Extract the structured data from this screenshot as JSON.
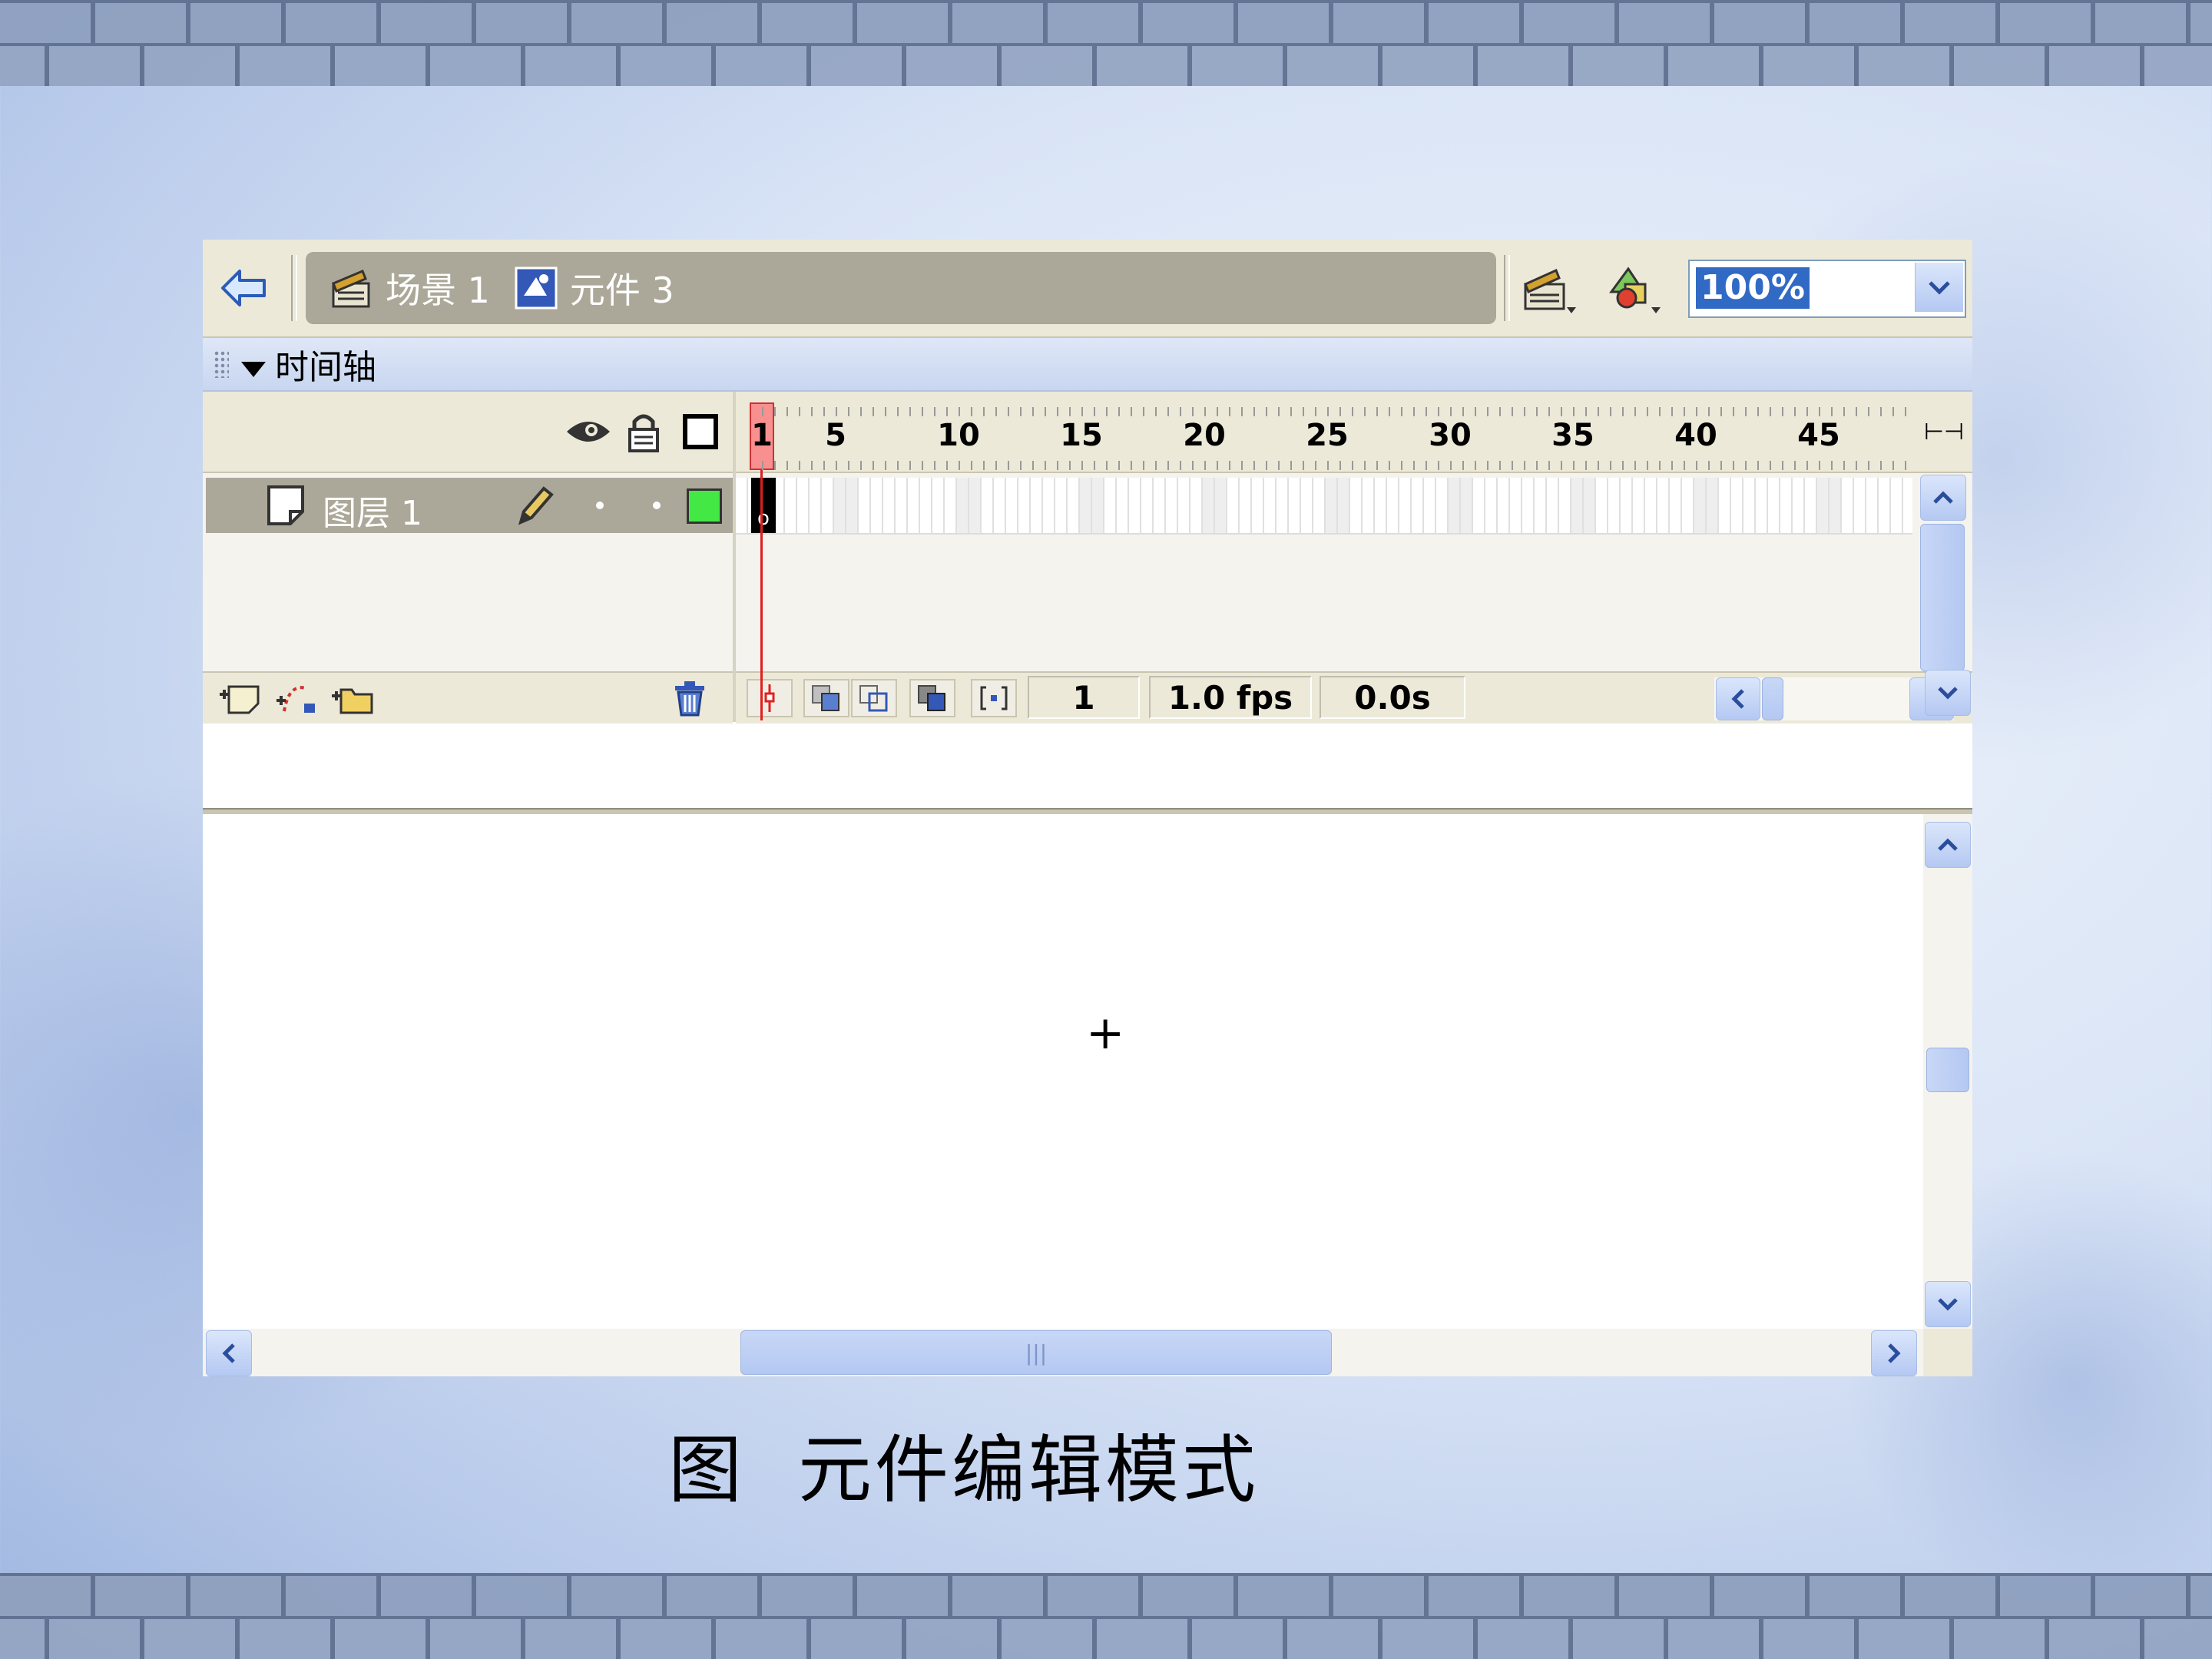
{
  "breadcrumb": {
    "scene_label": "场景 1",
    "symbol_label": "元件 3"
  },
  "toolbar": {
    "zoom_value": "100%",
    "edit_scene_icon": "clapper-icon",
    "edit_symbol_icon": "shapes-icon"
  },
  "timeline": {
    "title": "时间轴",
    "ruler_numbers": [
      "1",
      "5",
      "10",
      "15",
      "20",
      "25",
      "30",
      "35",
      "40",
      "45"
    ],
    "layers": [
      {
        "name": "图层 1",
        "color": "#44e844"
      }
    ],
    "keyframe_marker": "o",
    "current_frame": "1",
    "frame_rate": "1.0 fps",
    "elapsed_time": "0.0s"
  },
  "stage": {
    "registration_mark": "+"
  },
  "caption": "图  元件编辑模式",
  "colors": {
    "toolbar_bg": "#ece9d8",
    "breadcrumb_bg": "#aca899",
    "selection_blue": "#316ac5",
    "playhead_red": "#e02020"
  }
}
